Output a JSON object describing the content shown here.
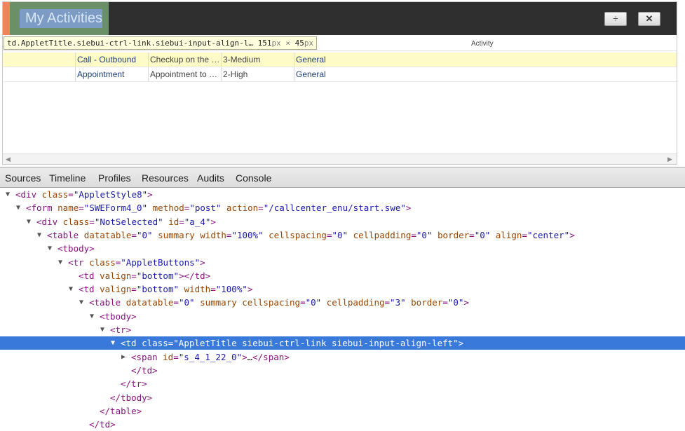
{
  "applet": {
    "title": "My Activities",
    "split_button": "÷",
    "close_button": "✕",
    "column_activity": "Activity"
  },
  "tooltip": {
    "selector": "td.AppletTitle.siebui-ctrl-link.siebui-input-align-l…",
    "width": "151",
    "width_unit": "px",
    "times": "×",
    "height": "45",
    "height_unit": "px"
  },
  "rows": [
    {
      "type": "Call - Outbound",
      "description": "Checkup on the …",
      "priority": "3-Medium",
      "category": "General",
      "selected": true
    },
    {
      "type": "Appointment",
      "description": "Appointment to …",
      "priority": "2-High",
      "category": "General",
      "selected": false
    }
  ],
  "scroll": {
    "left": "◀",
    "right": "▶"
  },
  "devtools": {
    "tabs": [
      "Sources",
      "Timeline",
      "Profiles",
      "Resources",
      "Audits",
      "Console"
    ],
    "tree": [
      {
        "indent": 0,
        "tri": "▼",
        "parts": [
          [
            "tag",
            "<div "
          ],
          [
            "attr",
            "class"
          ],
          [
            "tag",
            "="
          ],
          [
            "val",
            "\"AppletStyle8\""
          ],
          [
            "tag",
            ">"
          ]
        ]
      },
      {
        "indent": 1,
        "tri": "▼",
        "parts": [
          [
            "tag",
            "<form "
          ],
          [
            "attr",
            "name"
          ],
          [
            "tag",
            "="
          ],
          [
            "val",
            "\"SWEForm4_0\""
          ],
          [
            "tag",
            " "
          ],
          [
            "attr",
            "method"
          ],
          [
            "tag",
            "="
          ],
          [
            "val",
            "\"post\""
          ],
          [
            "tag",
            " "
          ],
          [
            "attr",
            "action"
          ],
          [
            "tag",
            "="
          ],
          [
            "val",
            "\"/callcenter_enu/start.swe\""
          ],
          [
            "tag",
            ">"
          ]
        ]
      },
      {
        "indent": 2,
        "tri": "▼",
        "parts": [
          [
            "tag",
            "<div "
          ],
          [
            "attr",
            "class"
          ],
          [
            "tag",
            "="
          ],
          [
            "val",
            "\"NotSelected\""
          ],
          [
            "tag",
            " "
          ],
          [
            "attr",
            "id"
          ],
          [
            "tag",
            "="
          ],
          [
            "val",
            "\"a_4\""
          ],
          [
            "tag",
            ">"
          ]
        ]
      },
      {
        "indent": 3,
        "tri": "▼",
        "parts": [
          [
            "tag",
            "<table "
          ],
          [
            "attr",
            "datatable"
          ],
          [
            "tag",
            "="
          ],
          [
            "val",
            "\"0\""
          ],
          [
            "tag",
            " "
          ],
          [
            "attr",
            "summary"
          ],
          [
            "tag",
            " "
          ],
          [
            "attr",
            "width"
          ],
          [
            "tag",
            "="
          ],
          [
            "val",
            "\"100%\""
          ],
          [
            "tag",
            " "
          ],
          [
            "attr",
            "cellspacing"
          ],
          [
            "tag",
            "="
          ],
          [
            "val",
            "\"0\""
          ],
          [
            "tag",
            " "
          ],
          [
            "attr",
            "cellpadding"
          ],
          [
            "tag",
            "="
          ],
          [
            "val",
            "\"0\""
          ],
          [
            "tag",
            " "
          ],
          [
            "attr",
            "border"
          ],
          [
            "tag",
            "="
          ],
          [
            "val",
            "\"0\""
          ],
          [
            "tag",
            " "
          ],
          [
            "attr",
            "align"
          ],
          [
            "tag",
            "="
          ],
          [
            "val",
            "\"center\""
          ],
          [
            "tag",
            ">"
          ]
        ]
      },
      {
        "indent": 4,
        "tri": "▼",
        "parts": [
          [
            "tag",
            "<tbody>"
          ]
        ]
      },
      {
        "indent": 5,
        "tri": "▼",
        "parts": [
          [
            "tag",
            "<tr "
          ],
          [
            "attr",
            "class"
          ],
          [
            "tag",
            "="
          ],
          [
            "val",
            "\"AppletButtons\""
          ],
          [
            "tag",
            ">"
          ]
        ]
      },
      {
        "indent": 6,
        "tri": "",
        "parts": [
          [
            "tag",
            "<td "
          ],
          [
            "attr",
            "valign"
          ],
          [
            "tag",
            "="
          ],
          [
            "val",
            "\"bottom\""
          ],
          [
            "tag",
            "></td>"
          ]
        ]
      },
      {
        "indent": 6,
        "tri": "▼",
        "parts": [
          [
            "tag",
            "<td "
          ],
          [
            "attr",
            "valign"
          ],
          [
            "tag",
            "="
          ],
          [
            "val",
            "\"bottom\""
          ],
          [
            "tag",
            " "
          ],
          [
            "attr",
            "width"
          ],
          [
            "tag",
            "="
          ],
          [
            "val",
            "\"100%\""
          ],
          [
            "tag",
            ">"
          ]
        ]
      },
      {
        "indent": 7,
        "tri": "▼",
        "parts": [
          [
            "tag",
            "<table "
          ],
          [
            "attr",
            "datatable"
          ],
          [
            "tag",
            "="
          ],
          [
            "val",
            "\"0\""
          ],
          [
            "tag",
            " "
          ],
          [
            "attr",
            "summary"
          ],
          [
            "tag",
            " "
          ],
          [
            "attr",
            "cellspacing"
          ],
          [
            "tag",
            "="
          ],
          [
            "val",
            "\"0\""
          ],
          [
            "tag",
            " "
          ],
          [
            "attr",
            "cellpadding"
          ],
          [
            "tag",
            "="
          ],
          [
            "val",
            "\"3\""
          ],
          [
            "tag",
            " "
          ],
          [
            "attr",
            "border"
          ],
          [
            "tag",
            "="
          ],
          [
            "val",
            "\"0\""
          ],
          [
            "tag",
            ">"
          ]
        ]
      },
      {
        "indent": 8,
        "tri": "▼",
        "parts": [
          [
            "tag",
            "<tbody>"
          ]
        ]
      },
      {
        "indent": 9,
        "tri": "▼",
        "parts": [
          [
            "tag",
            "<tr>"
          ]
        ]
      },
      {
        "indent": 10,
        "tri": "▼",
        "selected": true,
        "parts": [
          [
            "tag",
            "<td "
          ],
          [
            "attr",
            "class"
          ],
          [
            "tag",
            "="
          ],
          [
            "val",
            "\"AppletTitle siebui-ctrl-link siebui-input-align-left\""
          ],
          [
            "tag",
            ">"
          ]
        ]
      },
      {
        "indent": 11,
        "tri": "▶",
        "parts": [
          [
            "tag",
            "<span "
          ],
          [
            "attr",
            "id"
          ],
          [
            "tag",
            "="
          ],
          [
            "val",
            "\"s_4_1_22_0\""
          ],
          [
            "tag",
            ">"
          ],
          [
            "txt",
            "…"
          ],
          [
            "tag",
            "</span>"
          ]
        ]
      },
      {
        "indent": 11,
        "tri": "",
        "parts": [
          [
            "tag",
            "</td>"
          ]
        ]
      },
      {
        "indent": 10,
        "tri": "",
        "parts": [
          [
            "tag",
            "</tr>"
          ]
        ]
      },
      {
        "indent": 9,
        "tri": "",
        "parts": [
          [
            "tag",
            "</tbody>"
          ]
        ]
      },
      {
        "indent": 8,
        "tri": "",
        "parts": [
          [
            "tag",
            "</table>"
          ]
        ]
      },
      {
        "indent": 7,
        "tri": "",
        "parts": [
          [
            "tag",
            "</td>"
          ]
        ]
      }
    ]
  }
}
